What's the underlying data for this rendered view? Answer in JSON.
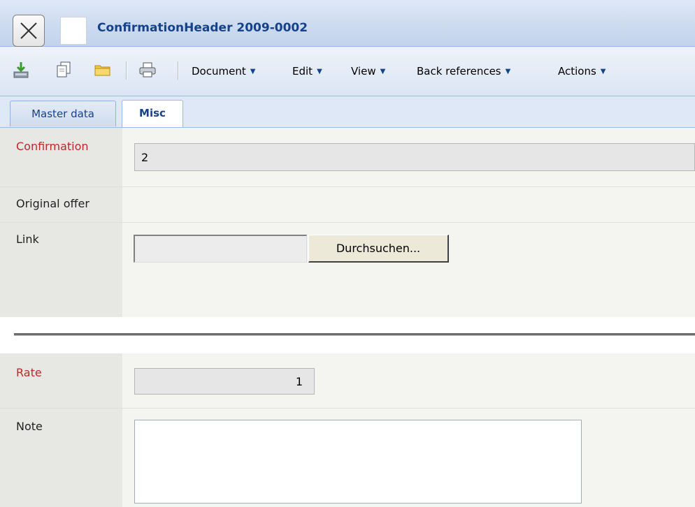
{
  "window": {
    "title": "ConfirmationHeader 2009-0002"
  },
  "toolbar": {
    "icons": [
      "save-icon",
      "copy-icon",
      "folder-icon",
      "print-icon"
    ],
    "menus": [
      "Document",
      "Edit",
      "View",
      "Back references",
      "Actions"
    ]
  },
  "tabs": [
    {
      "label": "Master data",
      "active": false
    },
    {
      "label": "Misc",
      "active": true
    }
  ],
  "form": {
    "confirmation": {
      "label": "Confirmation",
      "value": "2",
      "required": true
    },
    "original_offer": {
      "label": "Original offer"
    },
    "link": {
      "label": "Link",
      "value": "",
      "button_label": "Durchsuchen..."
    },
    "rate": {
      "label": "Rate",
      "value": "1",
      "required": true
    },
    "note": {
      "label": "Note",
      "value": ""
    }
  },
  "colors": {
    "title_text": "#15428b",
    "required_label": "#c0282a",
    "label_background": "#e7e7e3",
    "field_background": "#f4f4f0"
  }
}
